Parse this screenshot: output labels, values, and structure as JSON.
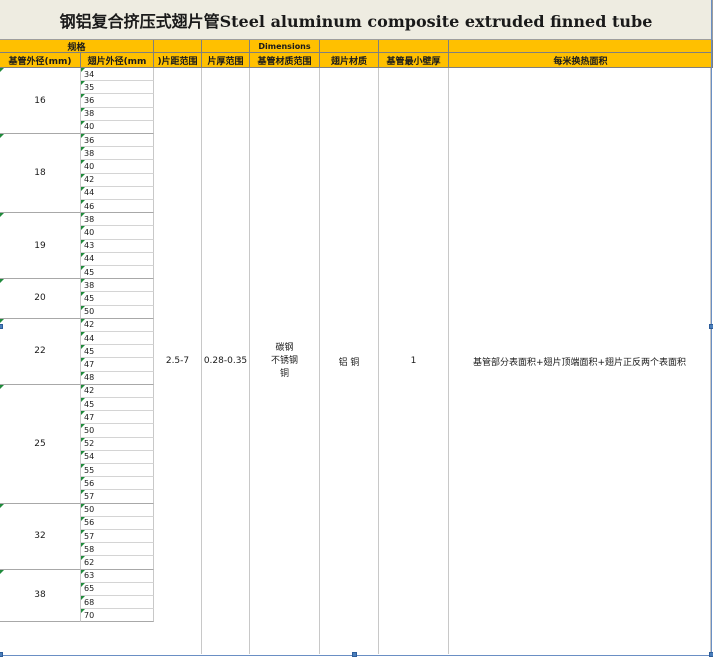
{
  "title": "钢铝复合挤压式翅片管Steel aluminum composite extruded finned tube",
  "header": {
    "spec": "规格",
    "dimensions": "Dimensions",
    "cols": [
      "基管外径(mm)",
      "翅片外径(mm",
      ")片距范围",
      "片厚范围",
      "基管材质范围",
      "翅片材质",
      "基管最小壁厚",
      "每米换热面积"
    ]
  },
  "groups": [
    {
      "base": "16",
      "fins": [
        "34",
        "35",
        "36",
        "38",
        "40"
      ]
    },
    {
      "base": "18",
      "fins": [
        "36",
        "38",
        "40",
        "42",
        "44",
        "46"
      ]
    },
    {
      "base": "19",
      "fins": [
        "38",
        "40",
        "43",
        "44",
        "45"
      ]
    },
    {
      "base": "20",
      "fins": [
        "38",
        "45",
        "50"
      ]
    },
    {
      "base": "22",
      "fins": [
        "42",
        "44",
        "45",
        "47",
        "48"
      ]
    },
    {
      "base": "25",
      "fins": [
        "42",
        "45",
        "47",
        "50",
        "52",
        "54",
        "55",
        "56",
        "57"
      ]
    },
    {
      "base": "32",
      "fins": [
        "50",
        "56",
        "57",
        "58",
        "62"
      ]
    },
    {
      "base": "38",
      "fins": [
        "63",
        "65",
        "68",
        "70"
      ]
    }
  ],
  "shared": {
    "pitch": "2.5-7",
    "thickness": "0.28-0.35",
    "base_material": [
      "碳钢",
      "不锈钢",
      "铜"
    ],
    "fin_material": "铝 铜",
    "min_wall": "1",
    "area": "基管部分表面积+翅片顶端面积+翅片正反两个表面积"
  },
  "colors": {
    "header": "#ffc000",
    "title_bg": "#eeece1",
    "marker": "#1f8a3b"
  }
}
